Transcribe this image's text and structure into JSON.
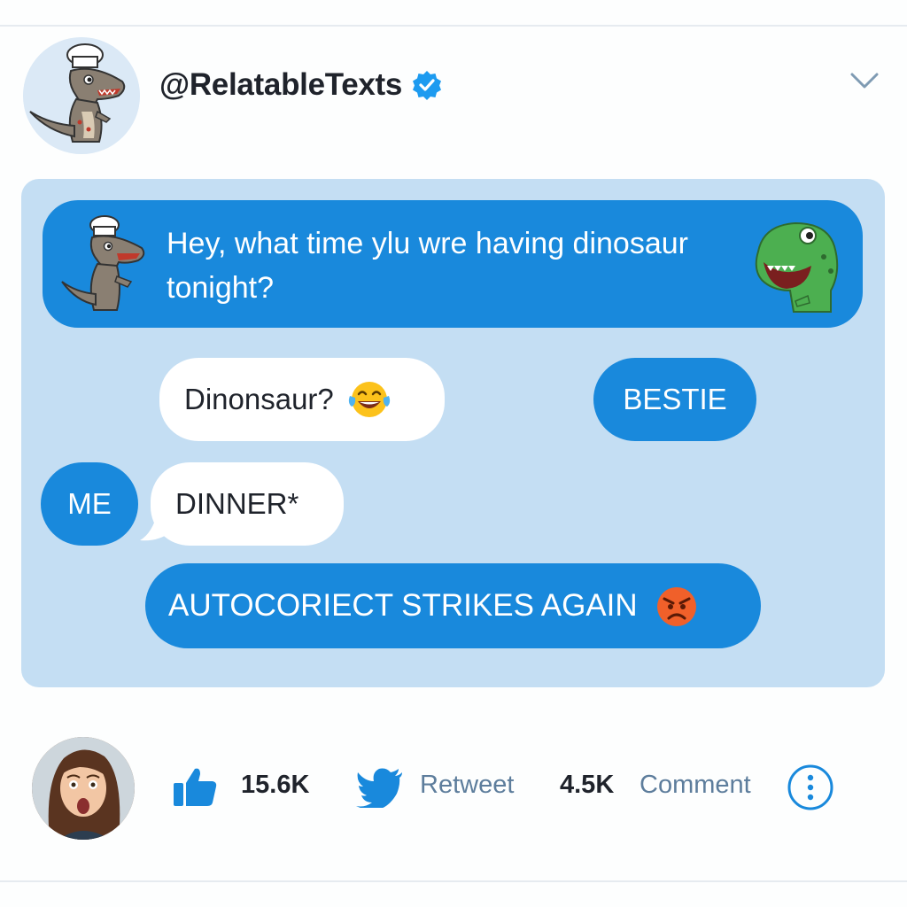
{
  "header": {
    "handle": "@RelatableTexts",
    "verified": true,
    "avatar_icon": "chef-dinosaur-icon"
  },
  "conversation": {
    "first_message": {
      "text": "Hey, what time ylu wre having dinosaur tonight?",
      "left_icon": "chef-dinosaur-icon",
      "right_icon": "green-dinosaur-icon"
    },
    "reply_question": {
      "text": "Dinonsaur?",
      "emoji": "laughing-tears-emoji"
    },
    "label_bestie": "BESTIE",
    "label_me": "ME",
    "correction": "DINNER*",
    "banner": {
      "text": "AUTOCORIECT STRIKES AGAIN",
      "emoji": "angry-face-emoji"
    }
  },
  "footer": {
    "user_avatar": "surprised-woman-avatar",
    "like_icon": "thumbs-up-icon",
    "like_count": "15.6K",
    "retweet_icon": "bird-icon",
    "retweet_label": "Retweet",
    "comment_count": "4.5K",
    "comment_label": "Comment",
    "more_icon": "more-options-icon"
  },
  "colors": {
    "accent_blue": "#1989dc",
    "card_background": "#c4def3",
    "muted_label": "#5d7d9c"
  }
}
